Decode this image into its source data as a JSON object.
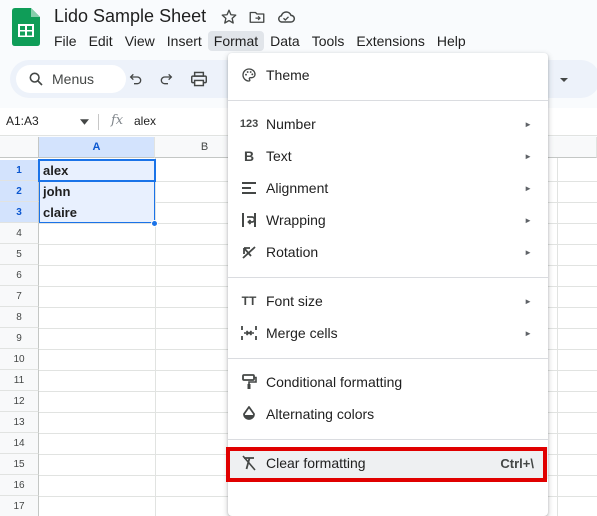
{
  "app": {
    "title": "Lido Sample Sheet"
  },
  "menubar": {
    "items": [
      "File",
      "Edit",
      "View",
      "Insert",
      "Format",
      "Data",
      "Tools",
      "Extensions",
      "Help"
    ],
    "active": "Format"
  },
  "toolbar": {
    "search_label": "Menus"
  },
  "formula_bar": {
    "name_box": "A1:A3",
    "fx_label": "fx",
    "value": "alex"
  },
  "grid": {
    "columns": [
      "A",
      "B"
    ],
    "rows": [
      "1",
      "2",
      "3",
      "4",
      "5",
      "6",
      "7",
      "8",
      "9",
      "10",
      "11",
      "12",
      "13",
      "14",
      "15",
      "16",
      "17"
    ],
    "cells": [
      "alex",
      "john",
      "claire"
    ]
  },
  "format_menu": {
    "theme": "Theme",
    "number": "Number",
    "text": "Text",
    "alignment": "Alignment",
    "wrapping": "Wrapping",
    "rotation": "Rotation",
    "font_size": "Font size",
    "merge_cells": "Merge cells",
    "conditional_formatting": "Conditional formatting",
    "alternating_colors": "Alternating colors",
    "clear_formatting": "Clear formatting",
    "clear_formatting_shortcut": "Ctrl+\\",
    "submenu_arrow": "►",
    "number_icon_text": "123",
    "text_icon_text": "B",
    "font_size_icon_text": "TT"
  },
  "colors": {
    "accent": "#1a73e8",
    "selection_fill": "#e8f0fe",
    "highlight_box": "#e00000",
    "sheets_green": "#0f9d58"
  }
}
